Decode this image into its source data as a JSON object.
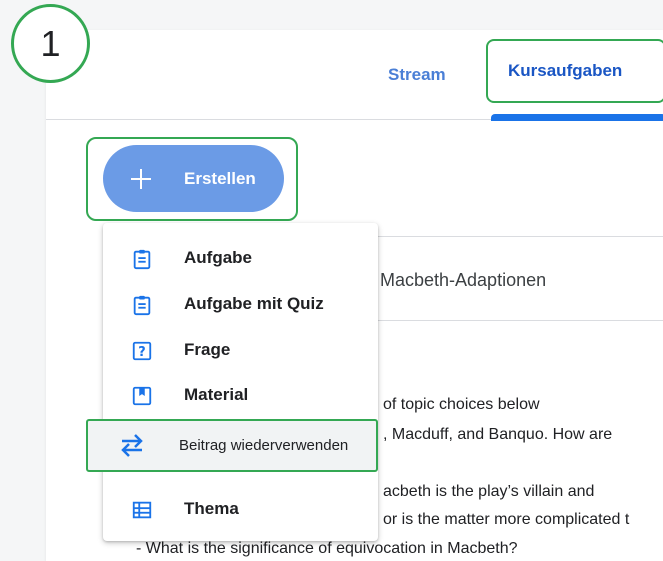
{
  "step_number": "1",
  "tabs": {
    "stream": "Stream",
    "kursaufgaben": "Kursaufgaben"
  },
  "create_button": {
    "label": "Erstellen"
  },
  "menu": {
    "items": [
      {
        "label": "Aufgabe",
        "icon": "assignment-icon"
      },
      {
        "label": "Aufgabe mit Quiz",
        "icon": "quiz-assignment-icon"
      },
      {
        "label": "Frage",
        "icon": "question-icon"
      },
      {
        "label": "Material",
        "icon": "material-icon"
      },
      {
        "label": "Beitrag wiederverwenden",
        "icon": "reuse-icon"
      },
      {
        "label": "Thema",
        "icon": "topic-icon"
      }
    ]
  },
  "background": {
    "card_title": "Macbeth-Adaptionen",
    "lines": [
      "of topic choices below",
      ", Macduff, and Banquo. How are",
      "acbeth is the play’s villain and",
      "or is the matter more complicated t",
      "- What is the significance of equivocation in Macbeth?"
    ]
  },
  "colors": {
    "highlight_green": "#34a853",
    "tab_blue": "#1a73e8",
    "create_button_blue": "#6b9be6",
    "icon_blue": "#1a73e8"
  }
}
